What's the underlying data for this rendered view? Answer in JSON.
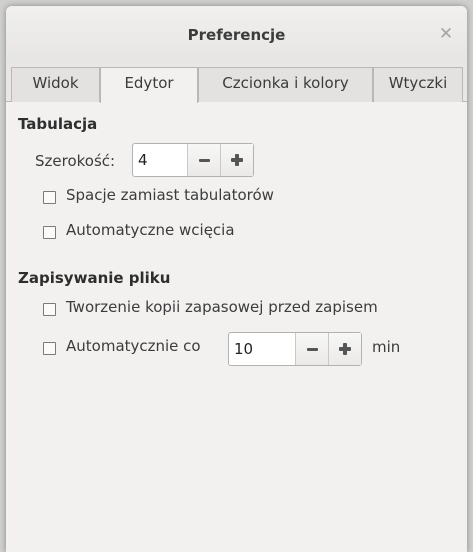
{
  "window": {
    "title": "Preferencje"
  },
  "tabs": [
    {
      "label": "Widok"
    },
    {
      "label": "Edytor"
    },
    {
      "label": "Czcionka i kolory"
    },
    {
      "label": "Wtyczki"
    }
  ],
  "tabulation": {
    "title": "Tabulacja",
    "width_label": "Szerokość:",
    "width_value": "4",
    "spaces_label": "Spacje zamiast tabulatorów",
    "auto_indent_label": "Automatyczne wcięcia"
  },
  "saving": {
    "title": "Zapisywanie pliku",
    "backup_label": "Tworzenie kopii zapasowej przed zapisem",
    "autosave_label": "Automatycznie co",
    "autosave_value": "10",
    "unit": "min"
  }
}
